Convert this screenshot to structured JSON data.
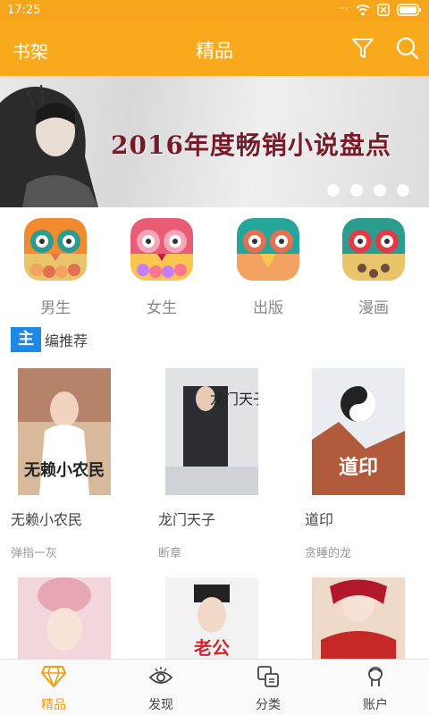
{
  "status_bar": {
    "time": "17:25"
  },
  "header": {
    "left_label": "书架",
    "title": "精品",
    "filter_icon": "filter-icon",
    "search_icon": "search-icon"
  },
  "banner": {
    "text": "2016年度畅销小说盘点",
    "page_count": 4
  },
  "categories": [
    {
      "label": "男生",
      "icon": "owl-male-icon"
    },
    {
      "label": "女生",
      "icon": "owl-female-icon"
    },
    {
      "label": "出版",
      "icon": "owl-publish-icon"
    },
    {
      "label": "漫画",
      "icon": "owl-comic-icon"
    }
  ],
  "section": {
    "badge": "主",
    "title": "编推荐"
  },
  "books": [
    {
      "title": "无赖小农民",
      "author": "弹指一灰",
      "cover_text": "无赖小农民"
    },
    {
      "title": "龙门天子",
      "author": "断章",
      "cover_text": "龙门天子"
    },
    {
      "title": "道印",
      "author": "贪睡的龙",
      "cover_text": "道印"
    }
  ],
  "books_row2": [
    {
      "cover_text": ""
    },
    {
      "cover_text": "老公"
    },
    {
      "cover_text": ""
    }
  ],
  "tabs": [
    {
      "label": "精品",
      "icon": "diamond-icon",
      "active": true
    },
    {
      "label": "发现",
      "icon": "eye-icon",
      "active": false
    },
    {
      "label": "分类",
      "icon": "category-icon",
      "active": false
    },
    {
      "label": "账户",
      "icon": "account-icon",
      "active": false
    }
  ],
  "colors": {
    "brand": "#f9a91c",
    "accent_blue": "#1e88e5",
    "active_tab": "#f39c12"
  }
}
